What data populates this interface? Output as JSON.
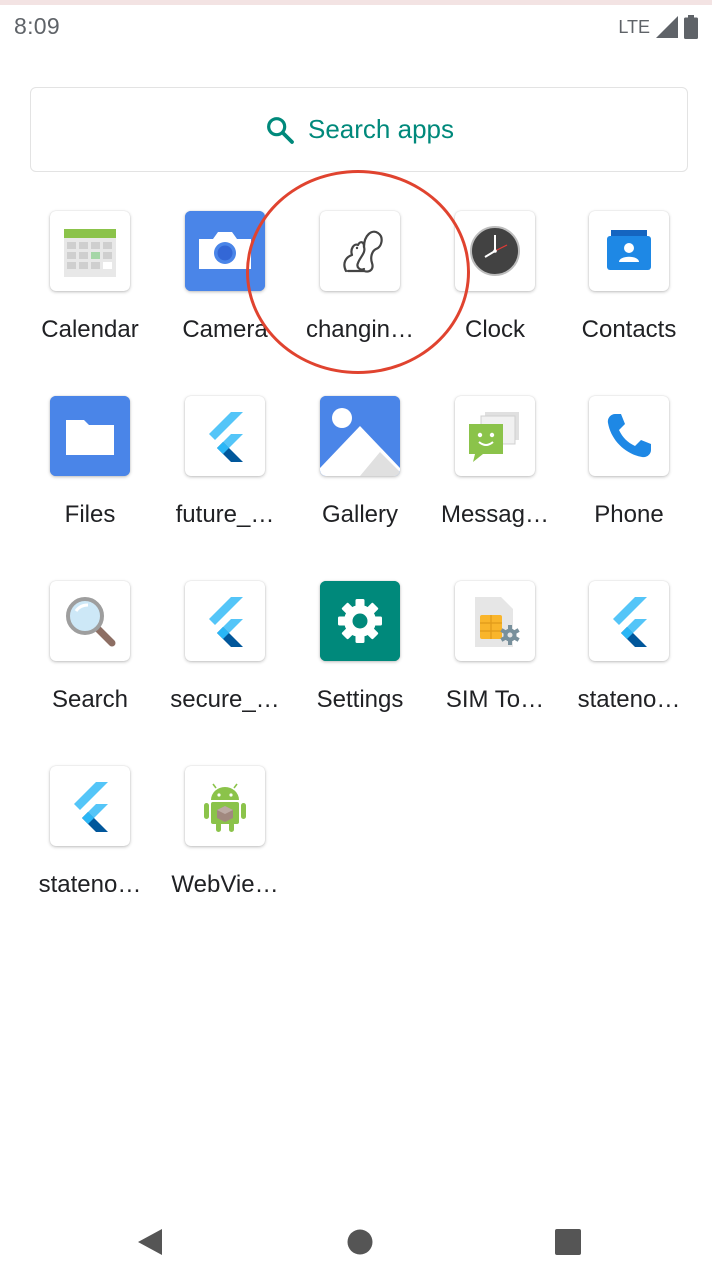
{
  "status_bar": {
    "time": "8:09",
    "network": "LTE"
  },
  "search": {
    "placeholder": "Search apps",
    "accent": "#00897b"
  },
  "apps": [
    {
      "label": "Calendar",
      "icon": "calendar-icon"
    },
    {
      "label": "Camera",
      "icon": "camera-icon"
    },
    {
      "label": "changin…",
      "icon": "squirrel-icon"
    },
    {
      "label": "Clock",
      "icon": "clock-icon"
    },
    {
      "label": "Contacts",
      "icon": "contacts-icon"
    },
    {
      "label": "Files",
      "icon": "folder-icon"
    },
    {
      "label": "future_…",
      "icon": "flutter-icon"
    },
    {
      "label": "Gallery",
      "icon": "gallery-icon"
    },
    {
      "label": "Messag…",
      "icon": "messages-icon"
    },
    {
      "label": "Phone",
      "icon": "phone-icon"
    },
    {
      "label": "Search",
      "icon": "magnifier-icon"
    },
    {
      "label": "secure_…",
      "icon": "flutter-icon"
    },
    {
      "label": "Settings",
      "icon": "gear-icon"
    },
    {
      "label": "SIM To…",
      "icon": "sim-card-icon"
    },
    {
      "label": "stateno…",
      "icon": "flutter-icon"
    },
    {
      "label": "stateno…",
      "icon": "flutter-icon"
    },
    {
      "label": "WebVie…",
      "icon": "android-icon"
    }
  ],
  "highlight_color": "#e0432f",
  "navigation": {
    "back": "back-icon",
    "home": "home-icon",
    "recents": "recents-icon"
  }
}
